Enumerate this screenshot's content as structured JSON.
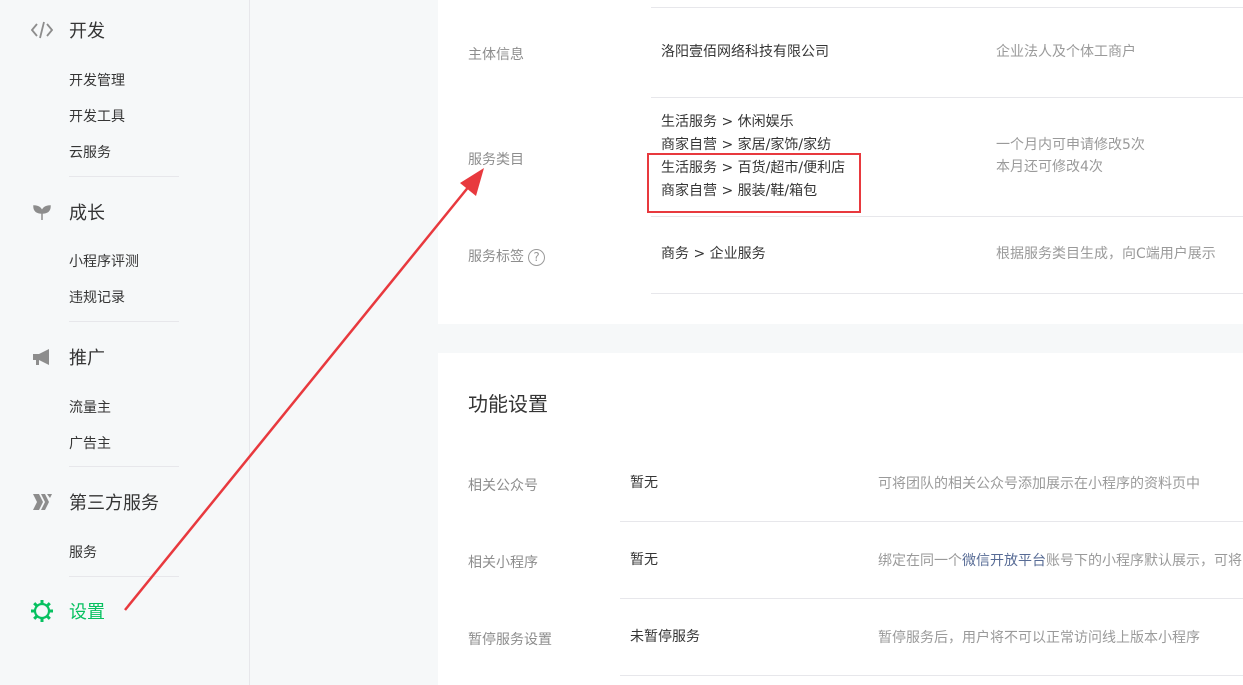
{
  "sidebar": {
    "groups": [
      {
        "label": "开发",
        "icon": "code-icon",
        "items": [
          "开发管理",
          "开发工具",
          "云服务"
        ]
      },
      {
        "label": "成长",
        "icon": "sprout-icon",
        "items": [
          "小程序评测",
          "违规记录"
        ]
      },
      {
        "label": "推广",
        "icon": "megaphone-icon",
        "items": [
          "流量主",
          "广告主"
        ]
      },
      {
        "label": "第三方服务",
        "icon": "third-party-icon",
        "items": [
          "服务"
        ]
      }
    ],
    "settings_label": "设置",
    "active_color": "#07c160"
  },
  "basic_info": {
    "subject": {
      "label": "主体信息",
      "value": "洛阳壹佰网络科技有限公司",
      "desc": "企业法人及个体工商户"
    },
    "category": {
      "label": "服务类目",
      "values": [
        "生活服务 > 休闲娱乐",
        "商家自营 > 家居/家饰/家纺",
        "生活服务 > 百货/超市/便利店",
        "商家自营 > 服装/鞋/箱包"
      ],
      "desc_line1": "一个月内可申请修改5次",
      "desc_line2": "本月还可修改4次"
    },
    "tag": {
      "label": "服务标签",
      "help": "?",
      "value": "商务 > 企业服务",
      "desc": "根据服务类目生成，向C端用户展示"
    }
  },
  "features": {
    "title": "功能设置",
    "rows": [
      {
        "label": "相关公众号",
        "value": "暂无",
        "desc": "可将团队的相关公众号添加展示在小程序的资料页中"
      },
      {
        "label": "相关小程序",
        "value": "暂无",
        "desc_pre": "绑定在同一个",
        "desc_link": "微信开放平台",
        "desc_post": "账号下的小程序默认展示，可将"
      },
      {
        "label": "暂停服务设置",
        "value": "未暂停服务",
        "desc": "暂停服务后，用户将不可以正常访问线上版本小程序"
      }
    ]
  },
  "annotation_color": "#e8393e"
}
